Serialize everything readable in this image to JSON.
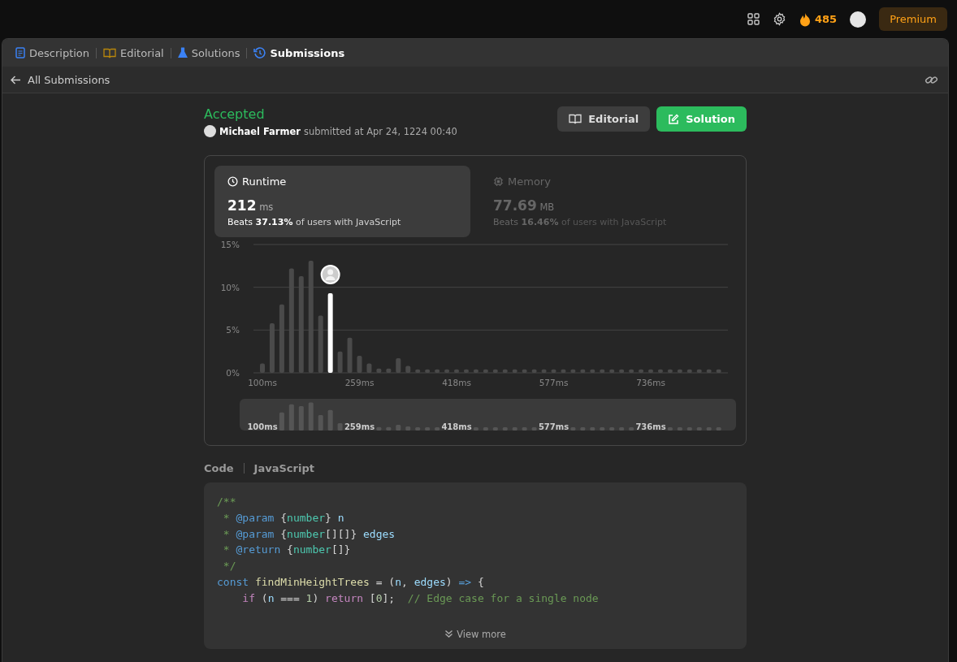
{
  "topbar": {
    "streak": "485",
    "premium": "Premium"
  },
  "tabs": [
    {
      "label": "Description",
      "selected": false
    },
    {
      "label": "Editorial",
      "selected": false
    },
    {
      "label": "Solutions",
      "selected": false
    },
    {
      "label": "Submissions",
      "selected": true
    }
  ],
  "back_link": "All Submissions",
  "submission": {
    "status": "Accepted",
    "user": "Michael Farmer",
    "submitted": "submitted at Apr 24, 1224 00:40",
    "buttons": [
      {
        "label": "Editorial",
        "kind": "secondary"
      },
      {
        "label": "Solution",
        "kind": "primary"
      }
    ]
  },
  "metrics": [
    {
      "title": "Runtime",
      "value": "212",
      "unit": "ms",
      "beats_prefix": "Beats",
      "beats": "37.13%",
      "beats_suffix": "of users with JavaScript",
      "selected": true
    },
    {
      "title": "Memory",
      "value": "77.69",
      "unit": "MB",
      "beats_prefix": "Beats",
      "beats": "16.46%",
      "beats_suffix": "of users with JavaScript",
      "selected": false
    }
  ],
  "chart": {
    "chart_data": {
      "type": "bar",
      "categories": [
        "100ms",
        null,
        null,
        null,
        null,
        null,
        null,
        null,
        null,
        null,
        "259ms",
        null,
        null,
        null,
        null,
        null,
        null,
        null,
        null,
        null,
        "418ms",
        null,
        null,
        null,
        null,
        null,
        null,
        null,
        null,
        null,
        "577ms",
        null,
        null,
        null,
        null,
        null,
        null,
        null,
        null,
        null,
        "736ms",
        null,
        null,
        null,
        null,
        null,
        null,
        null
      ],
      "series": [
        {
          "color": "#4a4a4a",
          "values": [
            1.1,
            5.8,
            8.0,
            12.2,
            11.3,
            13.1,
            6.7,
            null,
            2.5,
            4.1,
            2.0,
            1.1,
            0.5,
            0.5,
            1.7,
            0.8,
            0.4,
            0.4,
            0.4,
            0.4,
            0.4,
            0.4,
            0.4,
            0.4,
            0.4,
            0.4,
            0.4,
            0.4,
            0.4,
            0.4,
            0.4,
            0.4,
            0.4,
            0.4,
            0.4,
            0.4,
            0.4,
            0.4,
            0.4,
            0.4,
            0.4,
            0.4,
            0.4,
            0.4,
            0.4,
            0.4,
            0.4,
            0.4
          ]
        },
        {
          "color": "#ffffff",
          "values": [
            null,
            null,
            null,
            null,
            null,
            null,
            null,
            9.3,
            null,
            null,
            null,
            null,
            null,
            null,
            null,
            null,
            null,
            null,
            null,
            null,
            null,
            null,
            null,
            null,
            null,
            null,
            null,
            null,
            null,
            null,
            null,
            null,
            null,
            null,
            null,
            null,
            null,
            null,
            null,
            null,
            null,
            null,
            null,
            null,
            null,
            null,
            null,
            null
          ]
        }
      ],
      "ylim": [
        0,
        15
      ],
      "yticks": [
        {
          "value": 0,
          "label": "0%"
        },
        {
          "value": 5,
          "label": "5%"
        },
        {
          "value": 10,
          "label": "10%"
        },
        {
          "value": 15,
          "label": "15%"
        }
      ]
    },
    "overview_labels": [
      "100ms",
      "259ms",
      "418ms",
      "577ms",
      "736ms"
    ]
  },
  "code": {
    "title": "Code",
    "language": "JavaScript",
    "more": "View more",
    "lines": [
      [
        {
          "text": "/**",
          "kind": "comment"
        }
      ],
      [
        {
          "text": " * ",
          "kind": "comment"
        },
        {
          "text": "@param",
          "kind": "tag"
        },
        {
          "text": " {",
          "kind": "plain"
        },
        {
          "text": "number",
          "kind": "type"
        },
        {
          "text": "} ",
          "kind": "plain"
        },
        {
          "text": "n",
          "kind": "var"
        }
      ],
      [
        {
          "text": " * ",
          "kind": "comment"
        },
        {
          "text": "@param",
          "kind": "tag"
        },
        {
          "text": " {",
          "kind": "plain"
        },
        {
          "text": "number",
          "kind": "type"
        },
        {
          "text": "[][]} ",
          "kind": "plain"
        },
        {
          "text": "edges",
          "kind": "var"
        }
      ],
      [
        {
          "text": " * ",
          "kind": "comment"
        },
        {
          "text": "@return",
          "kind": "tag"
        },
        {
          "text": " {",
          "kind": "plain"
        },
        {
          "text": "number",
          "kind": "type"
        },
        {
          "text": "[]}",
          "kind": "plain"
        }
      ],
      [
        {
          "text": " */",
          "kind": "comment"
        }
      ],
      [
        {
          "text": "const",
          "kind": "keyword"
        },
        {
          "text": " findMinHeightTrees",
          "kind": "func"
        },
        {
          "text": " = (",
          "kind": "plain"
        },
        {
          "text": "n",
          "kind": "var"
        },
        {
          "text": ", ",
          "kind": "plain"
        },
        {
          "text": "edges",
          "kind": "var"
        },
        {
          "text": ") ",
          "kind": "plain"
        },
        {
          "text": "=>",
          "kind": "keyword"
        },
        {
          "text": " {",
          "kind": "plain"
        }
      ],
      [
        {
          "text": "    if",
          "kind": "control"
        },
        {
          "text": " (",
          "kind": "plain"
        },
        {
          "text": "n",
          "kind": "var"
        },
        {
          "text": " === ",
          "kind": "plain"
        },
        {
          "text": "1",
          "kind": "number"
        },
        {
          "text": ") ",
          "kind": "plain"
        },
        {
          "text": "return",
          "kind": "control"
        },
        {
          "text": " [",
          "kind": "plain"
        },
        {
          "text": "0",
          "kind": "number"
        },
        {
          "text": "];  ",
          "kind": "plain"
        },
        {
          "text": "// Edge case for a single node",
          "kind": "comment"
        }
      ]
    ]
  }
}
